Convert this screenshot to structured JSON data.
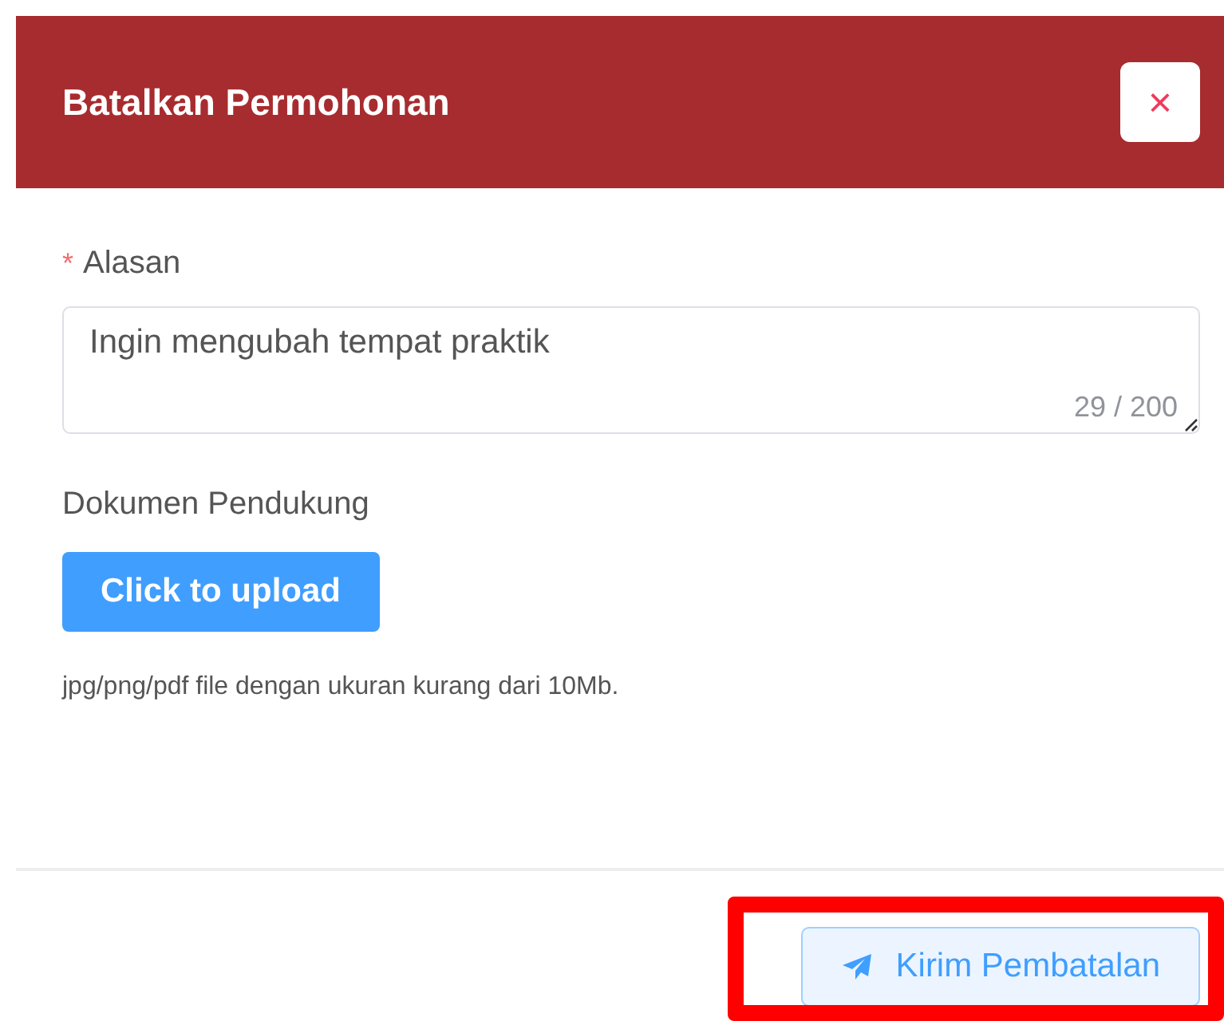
{
  "dialog": {
    "title": "Batalkan Permohonan",
    "close_icon": "×"
  },
  "reason": {
    "label": "Alasan",
    "required": true,
    "required_marker": "*",
    "value": "Ingin mengubah tempat praktik",
    "counter": "29 / 200"
  },
  "document": {
    "label": "Dokumen Pendukung",
    "upload_button": "Click to upload",
    "hint": "jpg/png/pdf file dengan ukuran kurang dari 10Mb."
  },
  "footer": {
    "submit_button": "Kirim Pembatalan",
    "highlighted": true
  }
}
